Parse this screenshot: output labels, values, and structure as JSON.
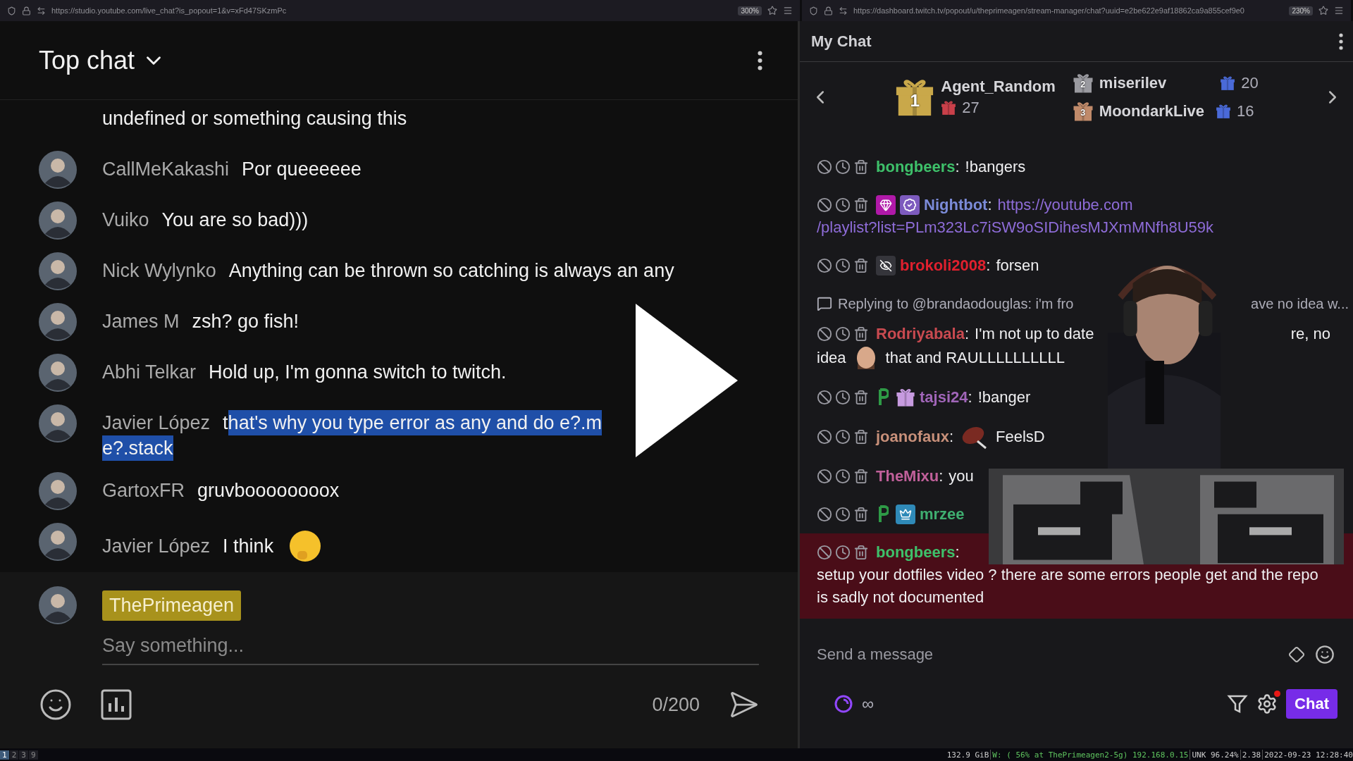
{
  "browser_bars": [
    {
      "url": "https://studio.youtube.com/live_chat?is_popout=1&v=xFd47SKzmPc",
      "zoom": "300%"
    },
    {
      "url": "https://dashboard.twitch.tv/popout/u/theprimeagen/stream-manager/chat?uuid=e2be622e9af18862ca9a855cef9e0",
      "zoom": "230%"
    }
  ],
  "youtube": {
    "title": "Top chat",
    "messages": [
      {
        "parts": [
          {
            "kind": "text",
            "text": "undefined or something causing this",
            "selected": false
          }
        ]
      },
      {
        "author": "CallMeKakashi",
        "parts": [
          {
            "kind": "text",
            "text": "Por queeeeee",
            "selected": false
          }
        ]
      },
      {
        "author": "Vuiko",
        "parts": [
          {
            "kind": "text",
            "text": "You are so bad)))",
            "selected": false
          }
        ]
      },
      {
        "author": "Nick Wylynko",
        "parts": [
          {
            "kind": "text",
            "text": "Anything can be thrown so catching is always an any",
            "selected": false
          }
        ]
      },
      {
        "author": "James M",
        "parts": [
          {
            "kind": "text",
            "text": "zsh? go fish!",
            "selected": false
          }
        ]
      },
      {
        "author": "Abhi Telkar",
        "parts": [
          {
            "kind": "text",
            "text": "Hold up, I'm gonna switch to twitch.",
            "selected": false
          }
        ]
      },
      {
        "author": "Javier López",
        "parts": [
          {
            "kind": "text",
            "text": "t",
            "selected": false
          },
          {
            "kind": "text",
            "text": "hat's why you type error as any and do e?.m",
            "selected": true
          },
          {
            "kind": "break"
          },
          {
            "kind": "text",
            "text": "e?.stack",
            "selected": true
          }
        ]
      },
      {
        "author": "GartoxFR",
        "parts": [
          {
            "kind": "text",
            "text": "gruvboooooooox",
            "selected": false
          }
        ]
      },
      {
        "author": "Javier López",
        "parts": [
          {
            "kind": "text",
            "text": "I think",
            "selected": false
          },
          {
            "kind": "emoji"
          }
        ]
      }
    ],
    "composer": {
      "author": "ThePrimeagen",
      "placeholder": "Say something...",
      "counter": "0/200"
    }
  },
  "twitch": {
    "title": "My Chat",
    "leaderboard": [
      {
        "rank": "1",
        "name": "Agent_Random",
        "count": "27"
      },
      {
        "rank": "2",
        "name": "miserilev",
        "count": "20"
      },
      {
        "rank": "3",
        "name": "MoondarkLive",
        "count": "16"
      }
    ],
    "messages": [
      {
        "kind": "message",
        "name": "bongbeers",
        "separator": ":",
        "color": "#3ec06a",
        "highlighted": false,
        "parts": [
          {
            "kind": "text",
            "text": "!bangers"
          }
        ]
      },
      {
        "kind": "message",
        "name": "Nightbot",
        "separator": ":",
        "color": "#7b8bd8",
        "highlighted": false,
        "badges": [
          {
            "kind": "gem"
          },
          {
            "kind": "verified"
          }
        ],
        "parts": [
          {
            "kind": "link",
            "text": "https://youtube.com"
          },
          {
            "kind": "link",
            "text": "/playlist?list=PLm323Lc7iSW9oSIDihesMJXmMNfh8U59k"
          }
        ]
      },
      {
        "kind": "message",
        "name": "brokoli2008",
        "separator": ":",
        "color": "#e0202e",
        "highlighted": false,
        "badges": [
          {
            "kind": "hidden"
          }
        ],
        "parts": [
          {
            "kind": "text",
            "text": "forsen"
          }
        ]
      },
      {
        "kind": "reply",
        "parts": [
          {
            "kind": "text",
            "text": "Replying to @brandaodouglas: i'm fro"
          },
          {
            "kind": "gap"
          },
          {
            "kind": "text",
            "text": "ave no idea w..."
          }
        ]
      },
      {
        "kind": "message",
        "name": "Rodriyabala",
        "separator": ":",
        "color": "#c94a50",
        "highlighted": false,
        "parts": [
          {
            "kind": "text",
            "text": "I'm not up to date"
          },
          {
            "kind": "gap"
          },
          {
            "kind": "text",
            "text": "re, no"
          },
          {
            "kind": "break"
          },
          {
            "kind": "text",
            "text": "idea"
          },
          {
            "kind": "emote"
          },
          {
            "kind": "text",
            "text": "that and RAULLLLLLLLLL"
          }
        ]
      },
      {
        "kind": "message",
        "name": "tajsi24",
        "separator": ":",
        "color": "#a065b8",
        "highlighted": false,
        "badges": [
          {
            "kind": "p"
          },
          {
            "kind": "gift"
          }
        ],
        "parts": [
          {
            "kind": "text",
            "text": "!banger"
          }
        ]
      },
      {
        "kind": "message",
        "name": "joanofaux",
        "separator": ":",
        "color": "#c8907a",
        "highlighted": false,
        "parts": [
          {
            "kind": "ball"
          },
          {
            "kind": "text",
            "text": "FeelsD"
          }
        ]
      },
      {
        "kind": "message",
        "name": "TheMixu",
        "separator": ":",
        "color": "#c0609a",
        "highlighted": false,
        "parts": [
          {
            "kind": "text",
            "text": "you"
          }
        ]
      },
      {
        "kind": "message",
        "name": "mrzee",
        "color": "#3fae70",
        "highlighted": false,
        "badges": [
          {
            "kind": "p"
          },
          {
            "kind": "crown"
          }
        ]
      },
      {
        "kind": "message",
        "name": "bongbeers",
        "separator": ":",
        "color": "#3ec06a",
        "highlighted": true,
        "parts": [
          {
            "kind": "text",
            "text": "setup your dotfiles video ? there are some errors people get and the repo is sadly not documented"
          }
        ]
      }
    ],
    "composer": {
      "placeholder": "Send a message",
      "infinity": "∞",
      "button": "Chat"
    }
  },
  "status_bar": {
    "workspaces": [
      {
        "label": "1",
        "selected": true
      },
      {
        "label": "2",
        "selected": false
      },
      {
        "label": "3",
        "selected": false
      },
      {
        "label": "9",
        "selected": false
      }
    ],
    "disk": "132.9 GiB",
    "wifi": "W: ( 56% at ThePrimeagen2-5g) 192.168.0.15",
    "battery": "UNK 96.24%",
    "load": "2.38",
    "clock": "2022-09-23 12:28:40"
  }
}
